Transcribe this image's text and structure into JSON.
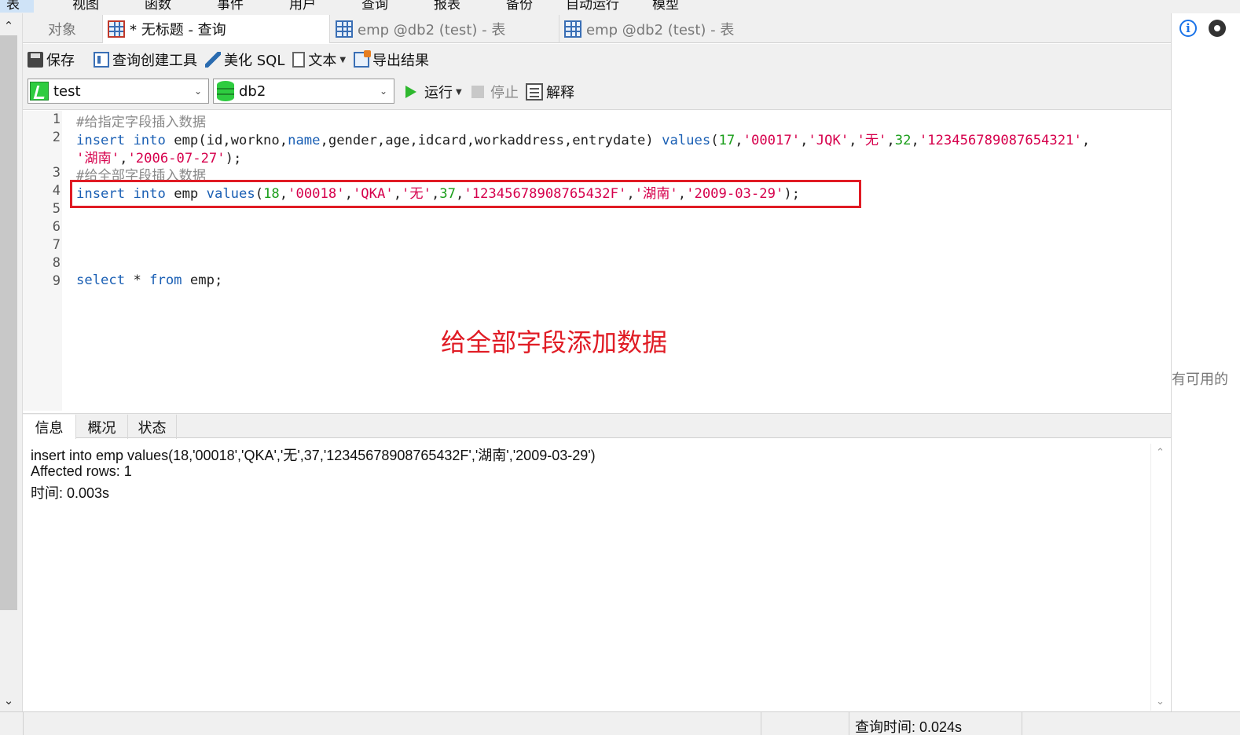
{
  "menu": {
    "items": [
      "表",
      "视图",
      "函数",
      "事件",
      "用户",
      "查询",
      "报表",
      "备份",
      "自动运行",
      "模型"
    ]
  },
  "tabs": {
    "objects": "对象",
    "query": "* 无标题 - 查询",
    "emp_table_1": "emp @db2 (test) - 表",
    "emp_table_2": "emp @db2 (test) - 表"
  },
  "toolbar": {
    "save": "保存",
    "query_builder": "查询创建工具",
    "beautify": "美化 SQL",
    "text": "文本",
    "export": "导出结果"
  },
  "connection": {
    "conn_name": "test",
    "db_name": "db2",
    "run": "运行",
    "stop": "停止",
    "explain": "解释"
  },
  "editor": {
    "line_numbers": [
      "1",
      "2",
      "3",
      "4",
      "5",
      "6",
      "7",
      "8",
      "9"
    ],
    "line1_comment": "#给指定字段插入数据",
    "line2": {
      "kw_insert": "insert",
      "kw_into": "into",
      "table": "emp",
      "cols_a": "(id,workno,",
      "col_name": "name",
      "cols_b": ",gender,age,idcard,workaddress,entrydate) ",
      "kw_values": "values",
      "open": "(",
      "v_id": "17",
      "v_workno": "'00017'",
      "v_name": "'JQK'",
      "v_gender": "'无'",
      "v_age": "32",
      "v_idcard": "'123456789087654321'",
      "v_addr": "'湖南'",
      "v_date": "'2006-07-27'",
      "close": ");"
    },
    "line3_comment": "#给全部字段插入数据",
    "line4": {
      "kw_insert": "insert",
      "kw_into": "into",
      "table": "emp",
      "kw_values": "values",
      "open": "(",
      "v_id": "18",
      "v_workno": "'00018'",
      "v_name": "'QKA'",
      "v_gender": "'无'",
      "v_age": "37",
      "v_idcard": "'12345678908765432F'",
      "v_addr": "'湖南'",
      "v_date": "'2009-03-29'",
      "close": ");"
    },
    "line9": {
      "kw_select": "select",
      "star": " * ",
      "kw_from": "from",
      "rest": " emp;"
    },
    "annotation": "给全部字段添加数据"
  },
  "result_tabs": {
    "info": "信息",
    "overview": "概况",
    "status": "状态"
  },
  "result": {
    "sql": "insert into emp values(18,'00018','QKA','无',37,'12345678908765432F','湖南','2009-03-29')",
    "affected": "Affected rows: 1",
    "time": "时间: 0.003s"
  },
  "right_panel": {
    "text": "有可用的"
  },
  "statusbar": {
    "query_time": "查询时间: 0.024s"
  },
  "colors": {
    "keyword": "#1a5fb4",
    "string": "#d6004c",
    "number": "#1a9e1a",
    "comment": "#8a8a8a",
    "annotation": "#e01b24"
  }
}
